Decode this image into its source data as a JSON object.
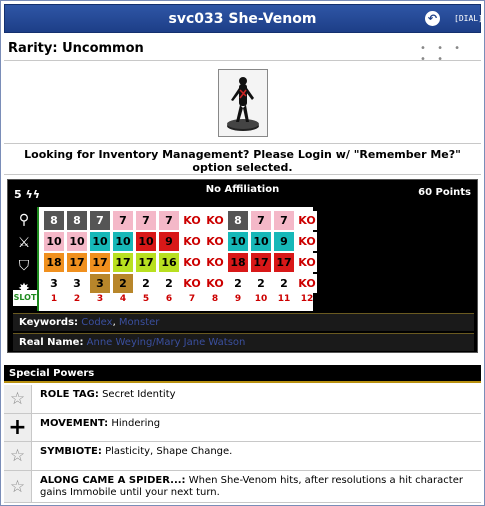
{
  "window": {
    "title": "svc033 She-Venom",
    "back_label": "↶",
    "dial_label": "[DIAL]"
  },
  "rarity": {
    "label": "Rarity: Uncommon",
    "dots": "• • • • •"
  },
  "notice": "Looking for Inventory Management? Please Login w/ \"Remember Me?\" option selected.",
  "dial": {
    "range": "5",
    "affiliation": "No Affiliation",
    "points": "60 Points",
    "slot_label": "SLOT",
    "stat_icons": [
      "speed-icon",
      "attack-icon",
      "defense-icon",
      "damage-icon"
    ],
    "click_numbers": [
      "1",
      "2",
      "3",
      "4",
      "5",
      "6",
      "7",
      "8",
      "9",
      "10",
      "11",
      "12"
    ],
    "rows": [
      [
        {
          "v": "8",
          "bg": "#555555",
          "fg": "#ffffff"
        },
        {
          "v": "8",
          "bg": "#555555",
          "fg": "#ffffff"
        },
        {
          "v": "7",
          "bg": "#555555",
          "fg": "#ffffff"
        },
        {
          "v": "7",
          "bg": "#f4b8c8",
          "fg": "#000000"
        },
        {
          "v": "7",
          "bg": "#f4b8c8",
          "fg": "#000000"
        },
        {
          "v": "7",
          "bg": "#f4b8c8",
          "fg": "#000000"
        },
        {
          "v": "KO",
          "bg": "#ffffff",
          "fg": "#cc0000"
        },
        {
          "v": "KO",
          "bg": "#ffffff",
          "fg": "#cc0000"
        },
        {
          "v": "8",
          "bg": "#555555",
          "fg": "#ffffff"
        },
        {
          "v": "7",
          "bg": "#f4b8c8",
          "fg": "#000000"
        },
        {
          "v": "7",
          "bg": "#f4b8c8",
          "fg": "#000000"
        },
        {
          "v": "KO",
          "bg": "#ffffff",
          "fg": "#cc0000"
        }
      ],
      [
        {
          "v": "10",
          "bg": "#f4b8c8",
          "fg": "#000000"
        },
        {
          "v": "10",
          "bg": "#f4b8c8",
          "fg": "#000000"
        },
        {
          "v": "10",
          "bg": "#16b8b8",
          "fg": "#000000"
        },
        {
          "v": "10",
          "bg": "#16b8b8",
          "fg": "#000000"
        },
        {
          "v": "10",
          "bg": "#d81818",
          "fg": "#000000"
        },
        {
          "v": "9",
          "bg": "#d81818",
          "fg": "#000000"
        },
        {
          "v": "KO",
          "bg": "#ffffff",
          "fg": "#cc0000"
        },
        {
          "v": "KO",
          "bg": "#ffffff",
          "fg": "#cc0000"
        },
        {
          "v": "10",
          "bg": "#16b8b8",
          "fg": "#000000"
        },
        {
          "v": "10",
          "bg": "#16b8b8",
          "fg": "#000000"
        },
        {
          "v": "9",
          "bg": "#16b8b8",
          "fg": "#000000"
        },
        {
          "v": "KO",
          "bg": "#ffffff",
          "fg": "#cc0000"
        }
      ],
      [
        {
          "v": "18",
          "bg": "#f0901e",
          "fg": "#000000"
        },
        {
          "v": "17",
          "bg": "#f0901e",
          "fg": "#000000"
        },
        {
          "v": "17",
          "bg": "#f0901e",
          "fg": "#000000"
        },
        {
          "v": "17",
          "bg": "#b8e020",
          "fg": "#000000"
        },
        {
          "v": "17",
          "bg": "#b8e020",
          "fg": "#000000"
        },
        {
          "v": "16",
          "bg": "#b8e020",
          "fg": "#000000"
        },
        {
          "v": "KO",
          "bg": "#ffffff",
          "fg": "#cc0000"
        },
        {
          "v": "KO",
          "bg": "#ffffff",
          "fg": "#cc0000"
        },
        {
          "v": "18",
          "bg": "#d81818",
          "fg": "#000000"
        },
        {
          "v": "17",
          "bg": "#d81818",
          "fg": "#000000"
        },
        {
          "v": "17",
          "bg": "#d81818",
          "fg": "#000000"
        },
        {
          "v": "KO",
          "bg": "#ffffff",
          "fg": "#cc0000"
        }
      ],
      [
        {
          "v": "3",
          "bg": "#ffffff",
          "fg": "#000000"
        },
        {
          "v": "3",
          "bg": "#ffffff",
          "fg": "#000000"
        },
        {
          "v": "3",
          "bg": "#b8862a",
          "fg": "#000000"
        },
        {
          "v": "2",
          "bg": "#b8862a",
          "fg": "#000000"
        },
        {
          "v": "2",
          "bg": "#ffffff",
          "fg": "#000000"
        },
        {
          "v": "2",
          "bg": "#ffffff",
          "fg": "#000000"
        },
        {
          "v": "KO",
          "bg": "#ffffff",
          "fg": "#cc0000"
        },
        {
          "v": "KO",
          "bg": "#ffffff",
          "fg": "#cc0000"
        },
        {
          "v": "2",
          "bg": "#ffffff",
          "fg": "#000000"
        },
        {
          "v": "2",
          "bg": "#ffffff",
          "fg": "#000000"
        },
        {
          "v": "2",
          "bg": "#ffffff",
          "fg": "#000000"
        },
        {
          "v": "KO",
          "bg": "#ffffff",
          "fg": "#cc0000"
        }
      ]
    ]
  },
  "keywords": {
    "label": "Keywords:",
    "items": [
      "Codex",
      "Monster"
    ],
    "sep": ", "
  },
  "real_name": {
    "label": "Real Name:",
    "value": "Anne Weying/Mary Jane Watson"
  },
  "special_powers": {
    "header": "Special Powers",
    "powers": [
      {
        "name": "ROLE TAG:",
        "text": " Secret Identity",
        "icon": "star-icon"
      },
      {
        "name": "MOVEMENT:",
        "text": " Hindering",
        "icon": "plus-icon"
      },
      {
        "name": "SYMBIOTE:",
        "text": " Plasticity, Shape Change.",
        "icon": "star-icon"
      },
      {
        "name": "ALONG CAME A SPIDER...:",
        "text": " When She-Venom hits, after resolutions a hit character gains Immobile until your next turn.",
        "icon": "star-icon"
      }
    ]
  }
}
